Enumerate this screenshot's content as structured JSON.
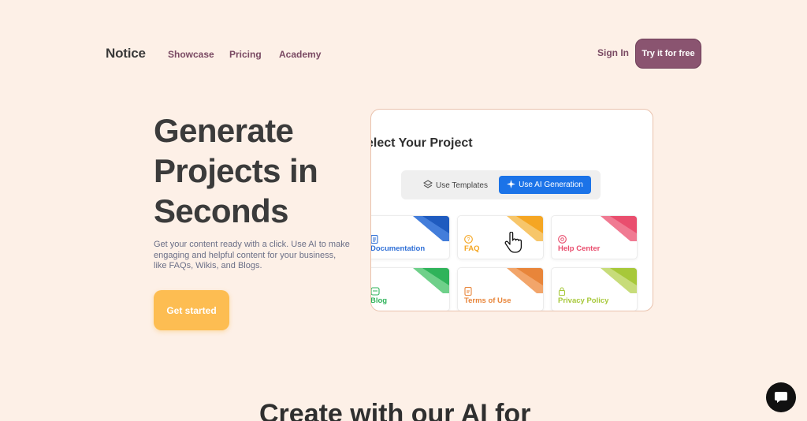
{
  "nav": {
    "logo": "Notice",
    "links": [
      "Showcase",
      "Pricing",
      "Academy"
    ],
    "signin": "Sign In",
    "try_button": "Try it for free"
  },
  "hero": {
    "title": "Generate Projects in Seconds",
    "subtitle": "Get your content ready with a click. Use AI to make engaging and helpful content for your business, like FAQs, Wikis, and Blogs.",
    "cta": "Get started"
  },
  "preview": {
    "title": "elect Your Project",
    "tabs": {
      "templates": "Use Templates",
      "ai": "Use AI Generation"
    },
    "tiles": [
      {
        "label": "Documentation",
        "color": "#2f6fd6",
        "icon": "document-icon"
      },
      {
        "label": "FAQ",
        "color": "#f5a623",
        "icon": "question-icon"
      },
      {
        "label": "Help Center",
        "color": "#e94e6e",
        "icon": "help-icon"
      },
      {
        "label": "Blog",
        "color": "#2fb35a",
        "icon": "blog-icon"
      },
      {
        "label": "Terms of Use",
        "color": "#e8853a",
        "icon": "terms-icon"
      },
      {
        "label": "Privacy Policy",
        "color": "#a7c83a",
        "icon": "lock-icon"
      }
    ]
  },
  "section": {
    "title": "Create with our AI for"
  },
  "colors": {
    "background": "#fdf0e7",
    "accent": "#8a5470",
    "cta": "#fdbd52",
    "ai_button": "#1b73e8"
  }
}
